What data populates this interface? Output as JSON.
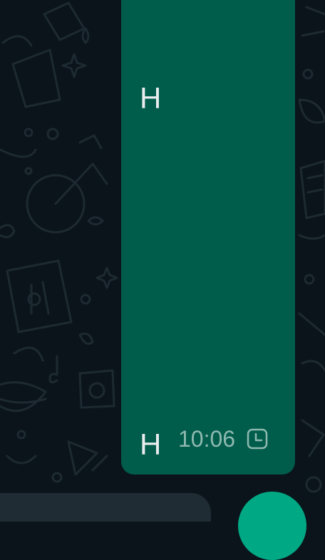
{
  "colors": {
    "background": "#0b141a",
    "doodle": "#1d2a31",
    "outgoing_bubble": "#005c4b",
    "message_text": "#e9edef",
    "meta_text": "#8fb9b0",
    "input_bar": "#1f2c33",
    "send_button": "#00a884"
  },
  "message": {
    "lines": [
      "H",
      "H"
    ],
    "time": "10:06",
    "status_icon": "clock-icon"
  },
  "composer": {
    "send_icon": "mic-icon"
  }
}
